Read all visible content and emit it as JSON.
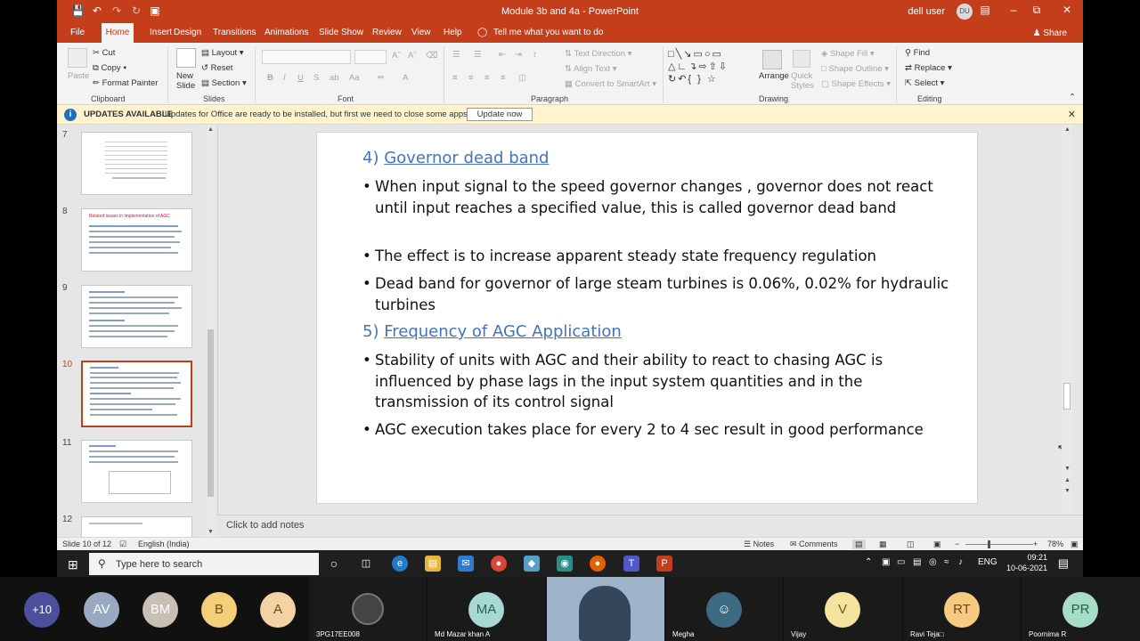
{
  "window": {
    "title": "Module 3b and 4a  -  PowerPoint",
    "user": "dell user",
    "user_initials": "DU"
  },
  "menu": {
    "tabs": [
      "File",
      "Home",
      "Insert",
      "Design",
      "Transitions",
      "Animations",
      "Slide Show",
      "Review",
      "View",
      "Help"
    ],
    "active": "Home",
    "tell_me": "Tell me what you want to do",
    "share": "Share"
  },
  "ribbon": {
    "clipboard": {
      "paste": "Paste",
      "cut": "Cut",
      "copy": "Copy",
      "format_painter": "Format Painter",
      "group": "Clipboard"
    },
    "slides": {
      "new_slide": "New Slide",
      "layout": "Layout",
      "reset": "Reset",
      "section": "Section",
      "group": "Slides"
    },
    "font": {
      "group": "Font"
    },
    "paragraph": {
      "text_direction": "Text Direction",
      "align_text": "Align Text",
      "smartart": "Convert to SmartArt",
      "group": "Paragraph"
    },
    "drawing": {
      "arrange": "Arrange",
      "quick_styles": "Quick Styles",
      "shape_fill": "Shape Fill",
      "shape_outline": "Shape Outline",
      "shape_effects": "Shape Effects",
      "group": "Drawing"
    },
    "editing": {
      "find": "Find",
      "replace": "Replace",
      "select": "Select",
      "group": "Editing"
    }
  },
  "update_bar": {
    "title": "UPDATES AVAILABLE",
    "message": "Updates for Office are ready to be installed, but first we need to close some apps.",
    "button": "Update now"
  },
  "thumbnails": [
    {
      "num": "7",
      "selected": false
    },
    {
      "num": "8",
      "selected": false,
      "title": "Related issues in implementation of AGC"
    },
    {
      "num": "9",
      "selected": false
    },
    {
      "num": "10",
      "selected": true
    },
    {
      "num": "11",
      "selected": false
    },
    {
      "num": "12",
      "selected": false
    }
  ],
  "slide": {
    "heading1_num": "4) ",
    "heading1": "Governor dead band",
    "bullets1": [
      "When input signal to the speed governor changes , governor does not react until input reaches  a specified value, this is called governor dead band",
      "The effect is to increase apparent steady state frequency regulation",
      "Dead band for governor of large steam turbines is 0.06%, 0.02% for hydraulic turbines"
    ],
    "heading2_num": "5) ",
    "heading2": "Frequency of AGC Application",
    "bullets2": [
      "Stability of units with AGC and their ability to react to chasing AGC is influenced by phase lags in the input system quantities and in the transmission of its control signal",
      "AGC execution takes place for every 2 to 4 sec result in good performance"
    ]
  },
  "notes_placeholder": "Click to add notes",
  "status": {
    "slide": "Slide 10 of 12",
    "language": "English (India)",
    "notes": "Notes",
    "comments": "Comments",
    "zoom": "78%"
  },
  "taskbar": {
    "search": "Type here to search",
    "lang": "ENG",
    "time": "09:21",
    "date": "10-06-2021"
  },
  "participants": [
    {
      "initials": "+10",
      "color": "#4b4f9c",
      "name": ""
    },
    {
      "initials": "AV",
      "color": "#9aa9c2",
      "name": ""
    },
    {
      "initials": "BM",
      "color": "#c8bfb5",
      "name": ""
    },
    {
      "initials": "B",
      "color": "#f3cf7a",
      "name": ""
    },
    {
      "initials": "A",
      "color": "#f3d3a4",
      "name": ""
    },
    {
      "initials": "",
      "color": "#222",
      "name": "3PG17EE008"
    },
    {
      "initials": "MA",
      "color": "#a8d8d3",
      "name": "Md Mazar khan A"
    },
    {
      "initials": "",
      "color": "#333",
      "name": ""
    },
    {
      "initials": "",
      "color": "#3c6a82",
      "name": "Megha"
    },
    {
      "initials": "V",
      "color": "#f5e3a0",
      "name": "Vijay"
    },
    {
      "initials": "RT",
      "color": "#f7c983",
      "name": "Ravi Teja□"
    },
    {
      "initials": "PR",
      "color": "#a7dcc6",
      "name": "Poornima R"
    }
  ]
}
